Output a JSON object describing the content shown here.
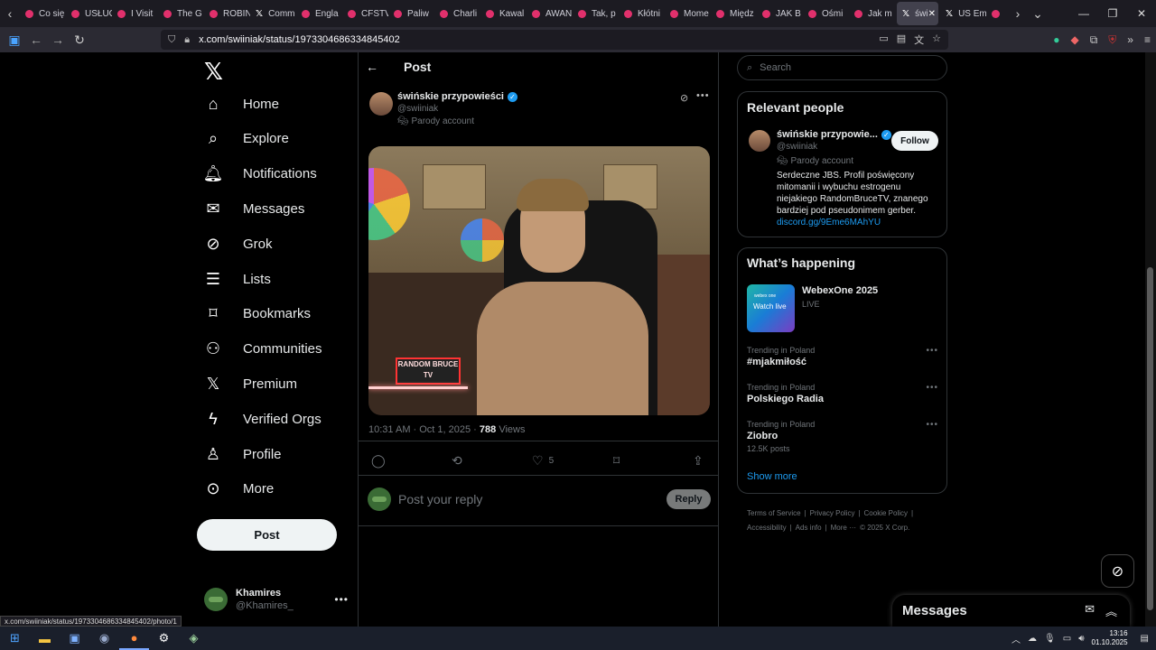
{
  "browser": {
    "tabs": [
      {
        "label": "Co się",
        "icon": "youtube-icon"
      },
      {
        "label": "USŁUG",
        "icon": "youtube-icon"
      },
      {
        "label": "I Visit",
        "icon": "youtube-icon"
      },
      {
        "label": "The G",
        "icon": "youtube-icon"
      },
      {
        "label": "ROBIN",
        "icon": "youtube-icon"
      },
      {
        "label": "Comm",
        "icon": "x-icon"
      },
      {
        "label": "Engla",
        "icon": "youtube-icon"
      },
      {
        "label": "CFSTV",
        "icon": "youtube-icon"
      },
      {
        "label": "Paliw",
        "icon": "youtube-icon"
      },
      {
        "label": "Charli",
        "icon": "youtube-icon"
      },
      {
        "label": "Kawal",
        "icon": "youtube-icon"
      },
      {
        "label": "AWAN",
        "icon": "youtube-icon"
      },
      {
        "label": "Tak, p",
        "icon": "youtube-icon"
      },
      {
        "label": "Kłótni",
        "icon": "youtube-icon"
      },
      {
        "label": "Mome",
        "icon": "youtube-icon"
      },
      {
        "label": "Międz",
        "icon": "youtube-icon"
      },
      {
        "label": "JAK B",
        "icon": "youtube-icon"
      },
      {
        "label": "Ośmi",
        "icon": "youtube-icon"
      },
      {
        "label": "Jak m",
        "icon": "youtube-icon"
      }
    ],
    "active_tab": "świ",
    "tab_after": "US Em",
    "url": "x.com/swiiniak/status/1973304686334845402",
    "status_link": "x.com/swiiniak/status/1973304686334845402/photo/1"
  },
  "nav": {
    "items": [
      {
        "label": "Home",
        "icon": "home-icon"
      },
      {
        "label": "Explore",
        "icon": "search-icon"
      },
      {
        "label": "Notifications",
        "icon": "bell-icon"
      },
      {
        "label": "Messages",
        "icon": "mail-icon"
      },
      {
        "label": "Grok",
        "icon": "grok-icon"
      },
      {
        "label": "Lists",
        "icon": "list-icon"
      },
      {
        "label": "Bookmarks",
        "icon": "bookmark-icon"
      },
      {
        "label": "Communities",
        "icon": "people-icon"
      },
      {
        "label": "Premium",
        "icon": "x-icon"
      },
      {
        "label": "Verified Orgs",
        "icon": "lightning-icon"
      },
      {
        "label": "Profile",
        "icon": "person-icon"
      },
      {
        "label": "More",
        "icon": "more-circle-icon"
      }
    ],
    "post_button": "Post",
    "account": {
      "name": "Khamires",
      "handle": "@Khamires_"
    }
  },
  "post": {
    "header_title": "Post",
    "author_name": "świńskie przypowieści",
    "author_handle": "@swiiniak",
    "parody_label": "Parody account",
    "image_sign": "RANDOM BRUCE TV",
    "time": "10:31 AM · Oct 1, 2025 · ",
    "views_count": "788",
    "views_label": " Views",
    "like_count": "5",
    "reply_placeholder": "Post your reply",
    "reply_button": "Reply"
  },
  "search": {
    "placeholder": "Search"
  },
  "relevant": {
    "title": "Relevant people",
    "name": "świńskie przypowie...",
    "handle": "@swiiniak",
    "parody": "Parody account",
    "follow": "Follow",
    "bio": "Serdeczne JBS. Profil poświęcony mitomanii i wybuchu estrogenu niejakiego RandomBruceTV, znanego bardziej pod pseudonimem gerber.",
    "link": "discord.gg/9Eme6MAhYU"
  },
  "happening": {
    "title": "What’s happening",
    "event_brand": "webex one",
    "event_badge": "Watch live",
    "event_title": "WebexOne 2025",
    "event_status": "LIVE",
    "trends": [
      {
        "context": "Trending in Poland",
        "title": "#mjakmiłość",
        "count": ""
      },
      {
        "context": "Trending in Poland",
        "title": "Polskiego Radia",
        "count": ""
      },
      {
        "context": "Trending in Poland",
        "title": "Ziobro",
        "count": "12.5K posts"
      }
    ],
    "show_more": "Show more"
  },
  "footer": {
    "links": [
      "Terms of Service",
      "|",
      "Privacy Policy",
      "|",
      "Cookie Policy",
      "|",
      "Accessibility",
      "|",
      "Ads info",
      "|",
      "More ···",
      "© 2025 X Corp."
    ]
  },
  "messages_dock": {
    "title": "Messages"
  },
  "taskbar": {
    "time": "13:16",
    "date": "01.10.2025"
  }
}
